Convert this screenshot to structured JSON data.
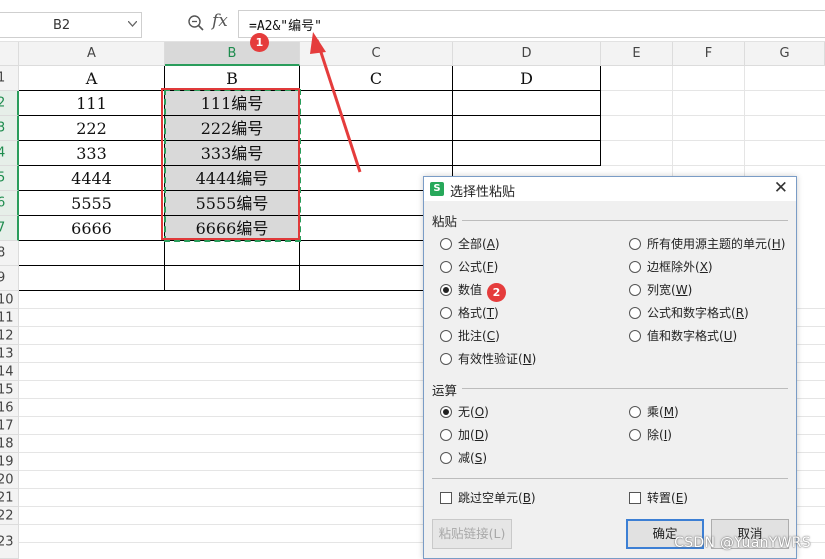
{
  "formula_bar": {
    "cell_ref": "B2",
    "fx_label": "fx",
    "formula": "=A2&\"编号\""
  },
  "columns": [
    "A",
    "B",
    "C",
    "D",
    "E",
    "F",
    "G"
  ],
  "selected_column": "B",
  "rows": [
    "1",
    "2",
    "3",
    "4",
    "5",
    "6",
    "7",
    "8",
    "9",
    "10",
    "11",
    "12",
    "13",
    "14",
    "15",
    "16",
    "17",
    "18",
    "19",
    "20",
    "21",
    "22",
    "23"
  ],
  "cells": {
    "A": [
      "A",
      "111",
      "222",
      "333",
      "4444",
      "5555",
      "6666"
    ],
    "B": [
      "B",
      "111编号",
      "222编号",
      "333编号",
      "4444编号",
      "5555编号",
      "6666编号"
    ],
    "C": [
      "C"
    ],
    "D": [
      "D"
    ]
  },
  "badges": {
    "one": "1",
    "two": "2"
  },
  "dialog": {
    "title": "选择性粘贴",
    "close": "✕",
    "paste_section": "粘贴",
    "paste_options_left": [
      {
        "label": "全部(",
        "key": "A",
        "end": ")",
        "selected": false
      },
      {
        "label": "公式(",
        "key": "F",
        "end": ")",
        "selected": false
      },
      {
        "label": "数值",
        "key": "",
        "end": "",
        "selected": true
      },
      {
        "label": "格式(",
        "key": "T",
        "end": ")",
        "selected": false
      },
      {
        "label": "批注(",
        "key": "C",
        "end": ")",
        "selected": false
      },
      {
        "label": "有效性验证(",
        "key": "N",
        "end": ")",
        "selected": false
      }
    ],
    "paste_options_right": [
      {
        "label": "所有使用源主题的单元(",
        "key": "H",
        "end": ")",
        "selected": false
      },
      {
        "label": "边框除外(",
        "key": "X",
        "end": ")",
        "selected": false
      },
      {
        "label": "列宽(",
        "key": "W",
        "end": ")",
        "selected": false
      },
      {
        "label": "公式和数字格式(",
        "key": "R",
        "end": ")",
        "selected": false
      },
      {
        "label": "值和数字格式(",
        "key": "U",
        "end": ")",
        "selected": false
      }
    ],
    "op_section": "运算",
    "op_options_left": [
      {
        "label": "无(",
        "key": "O",
        "end": ")",
        "selected": true
      },
      {
        "label": "加(",
        "key": "D",
        "end": ")",
        "selected": false
      },
      {
        "label": "减(",
        "key": "S",
        "end": ")",
        "selected": false
      }
    ],
    "op_options_right": [
      {
        "label": "乘(",
        "key": "M",
        "end": ")",
        "selected": false
      },
      {
        "label": "除(",
        "key": "I",
        "end": ")",
        "selected": false
      }
    ],
    "skip_blanks": {
      "label": "跳过空单元(",
      "key": "B",
      "end": ")"
    },
    "transpose": {
      "label": "转置(",
      "key": "E",
      "end": ")"
    },
    "paste_link": "粘贴链接(L)",
    "ok": "确定",
    "cancel": "取消"
  },
  "watermark": "CSDN @YuanYWRS"
}
